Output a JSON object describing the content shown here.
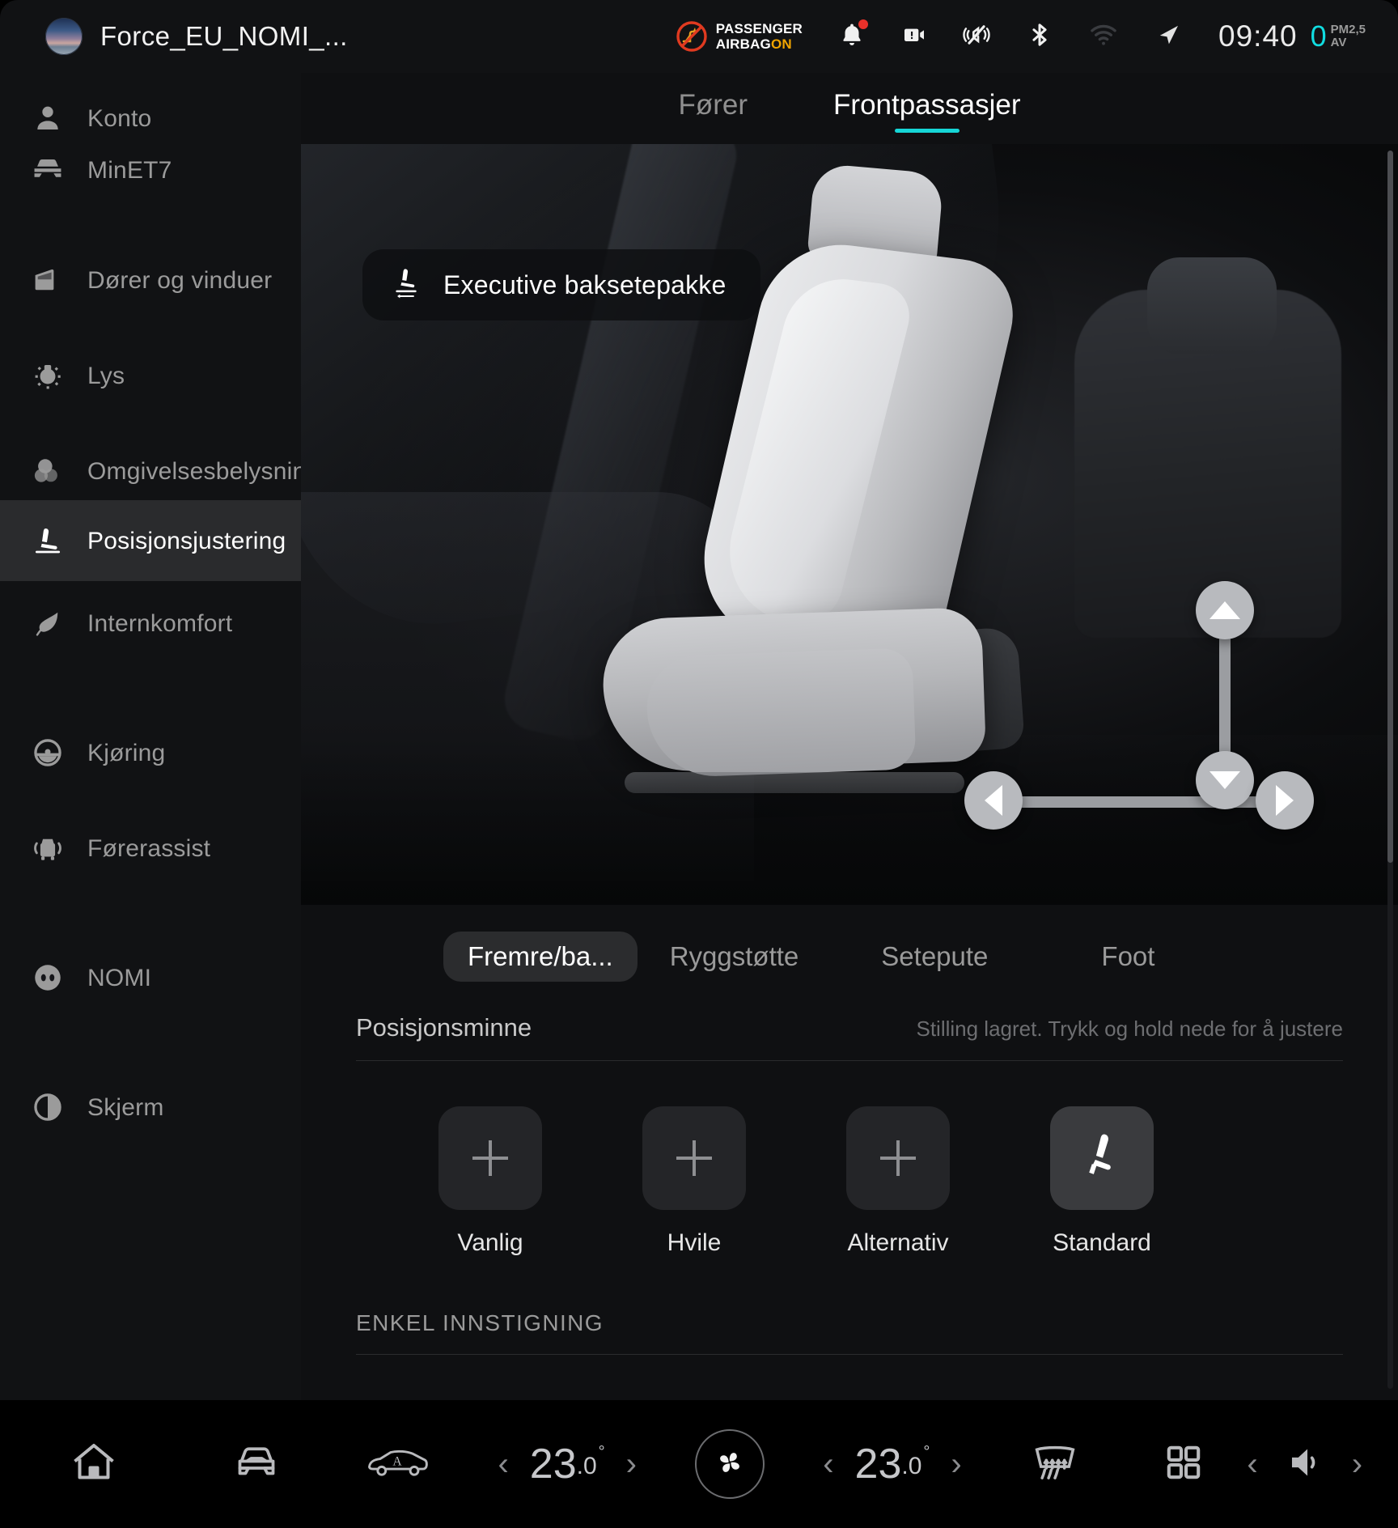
{
  "statusbar": {
    "window_title": "Force_EU_NOMI_...",
    "airbag_line1": "PASSENGER",
    "airbag_line2": "AIRBAG",
    "airbag_state": "ON",
    "clock": "09:40",
    "pm_value": "0",
    "pm_label_1": "PM2,5",
    "pm_label_2": "AV",
    "icons": {
      "airbag": "passenger-airbag-off-icon",
      "bell": "notification-bell-icon",
      "dashcam": "dashcam-icon",
      "mute": "sound-muted-icon",
      "bluetooth": "bluetooth-icon",
      "wifi": "wifi-icon",
      "navigation": "navigation-arrow-icon"
    },
    "accent_cyan": "#11dce0",
    "accent_amber": "#f0a400",
    "accent_red": "#e8312a"
  },
  "sidebar": {
    "items": [
      {
        "label": "Konto",
        "icon": "person-icon",
        "active": false
      },
      {
        "label": "MinET7",
        "icon": "car-front-icon",
        "active": false
      },
      {
        "label": "Dører og vinduer",
        "icon": "car-door-icon",
        "active": false
      },
      {
        "label": "Lys",
        "icon": "light-bulb-icon",
        "active": false
      },
      {
        "label": "Omgivelsesbelysning",
        "icon": "ambient-light-icon",
        "active": false
      },
      {
        "label": "Posisjonsjustering",
        "icon": "seat-position-icon",
        "active": true
      },
      {
        "label": "Internkomfort",
        "icon": "leaf-icon",
        "active": false
      },
      {
        "label": "Kjøring",
        "icon": "steering-wheel-icon",
        "active": false
      },
      {
        "label": "Førerassist",
        "icon": "driver-assist-icon",
        "active": false
      },
      {
        "label": "NOMI",
        "icon": "nomi-face-icon",
        "active": false
      },
      {
        "label": "Skjerm",
        "icon": "display-brightness-icon",
        "active": false
      }
    ]
  },
  "main": {
    "top_tabs": [
      {
        "label": "Fører",
        "active": false
      },
      {
        "label": "Frontpassasjer",
        "active": true
      }
    ],
    "package_badge": {
      "label": "Executive baksetepakke",
      "icon": "seat-slide-icon"
    },
    "seat_controls": {
      "up": "seat-move-up-button",
      "down": "seat-move-down-button",
      "left": "seat-move-forward-button",
      "right": "seat-move-back-button"
    },
    "segment_tabs": [
      {
        "label": "Fremre/ba...",
        "active": true
      },
      {
        "label": "Ryggstøtte",
        "active": false
      },
      {
        "label": "Setepute",
        "active": false
      },
      {
        "label": "Foot",
        "active": false
      }
    ],
    "memory": {
      "title": "Posisjonsminne",
      "hint": "Stilling lagret. Trykk og hold nede for å justere",
      "presets": [
        {
          "label": "Vanlig",
          "filled": false,
          "icon": "plus-icon"
        },
        {
          "label": "Hvile",
          "filled": false,
          "icon": "plus-icon"
        },
        {
          "label": "Alternativ",
          "filled": false,
          "icon": "plus-icon"
        },
        {
          "label": "Standard",
          "filled": true,
          "icon": "seat-icon"
        }
      ]
    },
    "easy_entry": {
      "title": "ENKEL INNSTIGNING"
    }
  },
  "bottombar": {
    "home": "home-icon",
    "car": "car-front-icon",
    "car_auto": "car-side-auto-icon",
    "temp_left": {
      "whole": "23",
      "decimal": ".0",
      "degree": "°"
    },
    "temp_right": {
      "whole": "23",
      "decimal": ".0",
      "degree": "°"
    },
    "fan": "fan-icon",
    "defrost": "rear-defrost-icon",
    "apps": "apps-grid-icon",
    "volume": "volume-icon",
    "chev_left": "‹",
    "chev_right": "›"
  }
}
